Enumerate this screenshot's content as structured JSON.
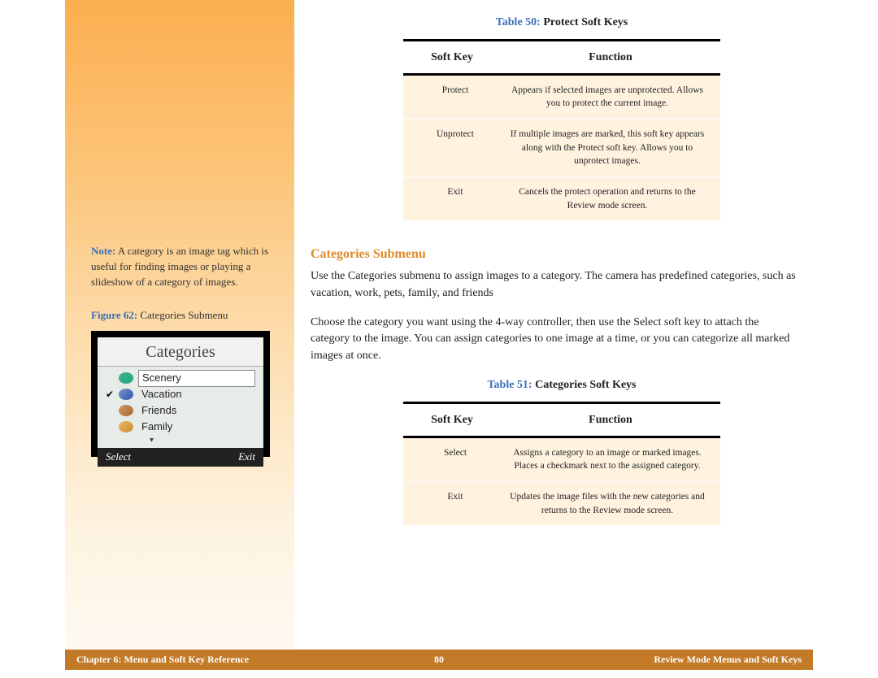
{
  "sidebar": {
    "note_label": "Note:",
    "note_text": " A category is an image tag which is useful for finding images or playing a slideshow of a category of images.",
    "figure_num": "Figure 62:",
    "figure_title": " Categories Submenu",
    "screen": {
      "title": "Categories",
      "items": [
        "Scenery",
        "Vacation",
        "Friends",
        "Family"
      ],
      "btn_left": "Select",
      "btn_right": "Exit"
    }
  },
  "table50": {
    "label": "Table 50:",
    "title": " Protect Soft Keys",
    "col1": "Soft Key",
    "col2": "Function",
    "rows": [
      {
        "k": "Protect",
        "f": "Appears if selected images are unprotected. Allows you to protect the current image."
      },
      {
        "k": "Unprotect",
        "f": "If multiple images are marked, this soft key appears along with the Protect soft key. Allows you to unprotect images."
      },
      {
        "k": "Exit",
        "f": "Cancels the protect operation and returns to the Review mode screen."
      }
    ]
  },
  "section": {
    "heading": "Categories Submenu",
    "p1": "Use the Categories submenu to assign images to a category. The camera has predefined categories, such as vacation, work, pets, family, and friends",
    "p2": "Choose the category you want using the 4-way controller, then use the Select soft key to attach the category to the image. You can assign categories to one image at a time, or you can categorize all marked images at once."
  },
  "table51": {
    "label": "Table 51:",
    "title": " Categories Soft Keys",
    "col1": "Soft Key",
    "col2": "Function",
    "rows": [
      {
        "k": "Select",
        "f": "Assigns a category to an image or marked images. Places a checkmark next to the assigned category."
      },
      {
        "k": "Exit",
        "f": "Updates the image files with the new categories and returns to the Review mode screen."
      }
    ]
  },
  "footer": {
    "left": "Chapter 6: Menu and Soft Key Reference",
    "mid": "80",
    "right": "Review Mode Menus and Soft Keys"
  }
}
